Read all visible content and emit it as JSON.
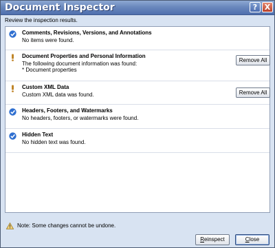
{
  "window": {
    "title": "Document Inspector",
    "help_label": "?",
    "close_label": "X",
    "subtitle": "Review the inspection results."
  },
  "results": [
    {
      "title": "Comments, Revisions, Versions, and Annotations",
      "description": "No items were found.",
      "status": "ok",
      "button": ""
    },
    {
      "title": "Document Properties and Personal Information",
      "description": "The following document information was found:",
      "bullet": "* Document properties",
      "status": "warning",
      "button": "Remove All"
    },
    {
      "title": "Custom XML Data",
      "description": "Custom XML data was found.",
      "status": "warning",
      "button": "Remove All"
    },
    {
      "title": "Headers, Footers, and Watermarks",
      "description": "No headers, footers, or watermarks were found.",
      "status": "ok",
      "button": ""
    },
    {
      "title": "Hidden Text",
      "description": "No hidden text was found.",
      "status": "ok",
      "button": ""
    }
  ],
  "footer": {
    "note": "Note: Some changes cannot be undone.",
    "reinspect_label_first": "R",
    "reinspect_label_rest": "einspect",
    "close_label_first": "C",
    "close_label_rest": "lose"
  },
  "colors": {
    "titlebar": "#4f6fae",
    "ok_icon": "#2f6fd0",
    "warning_icon": "#c0862a",
    "dialog_bg": "#d8e3f2"
  }
}
